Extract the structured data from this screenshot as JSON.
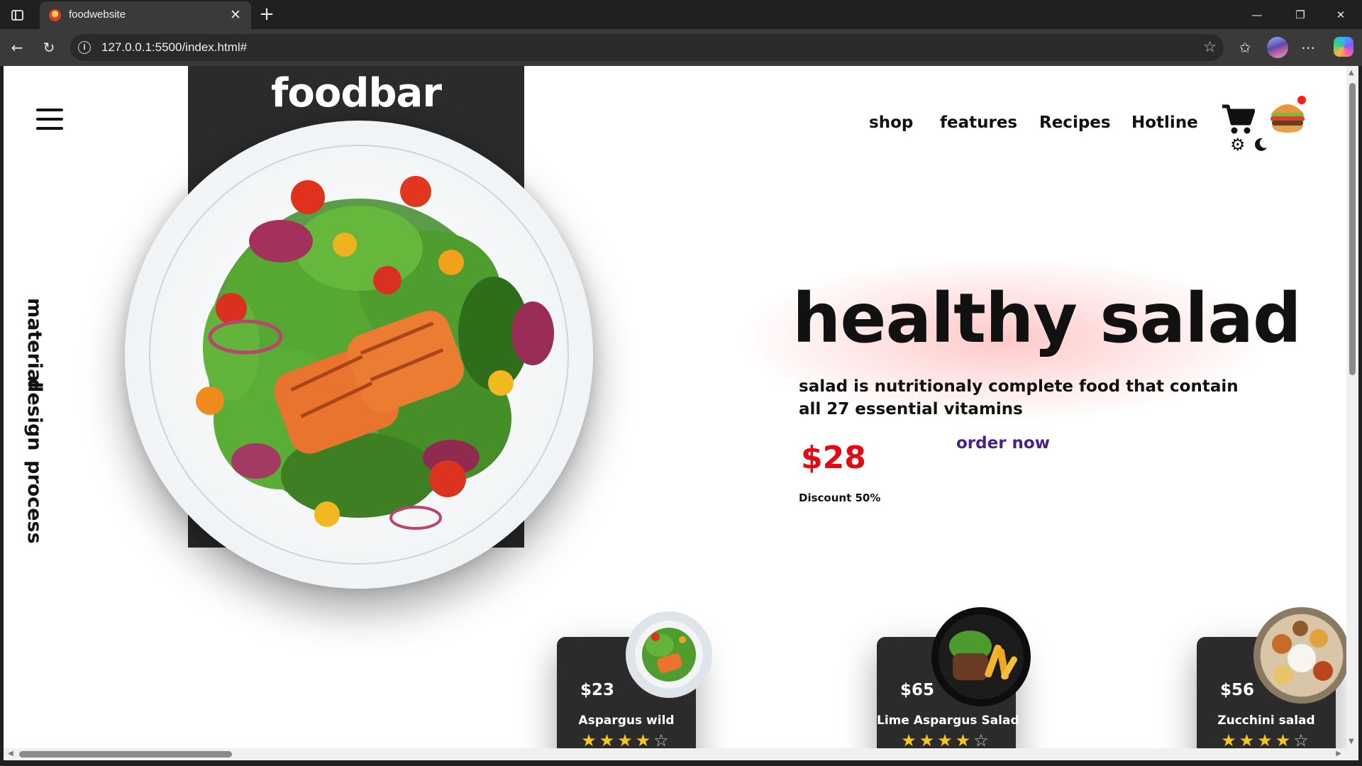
{
  "browser": {
    "tab_title": "foodwebsite",
    "url": "127.0.0.1:5500/index.html#"
  },
  "site": {
    "logo": "foodbar",
    "side_nav": [
      "material",
      "design",
      "process"
    ],
    "nav": [
      "shop",
      "features",
      "Recipes",
      "Hotline"
    ],
    "hero": {
      "title": "healthy salad",
      "description": "salad is nutritionaly complete food that contain all 27 essential vitamins",
      "price": "$28",
      "order_label": "order now",
      "discount": "Discount 50%"
    },
    "cards": [
      {
        "price": "$23",
        "name": "Aspargus wild",
        "rating": 4
      },
      {
        "price": "$65",
        "name": "Lime Aspargus Salad",
        "rating": 4
      },
      {
        "price": "$56",
        "name": "Zucchini salad",
        "rating": 4
      }
    ]
  },
  "colors": {
    "accent_red": "#e50914",
    "order_purple": "#4a1f8a",
    "star_gold": "#f6c814",
    "dark_panel": "#2b2b2b"
  },
  "icons": [
    "hamburger-menu-icon",
    "cart-icon",
    "burger-icon",
    "gear-icon",
    "moon-icon",
    "star-icon"
  ]
}
